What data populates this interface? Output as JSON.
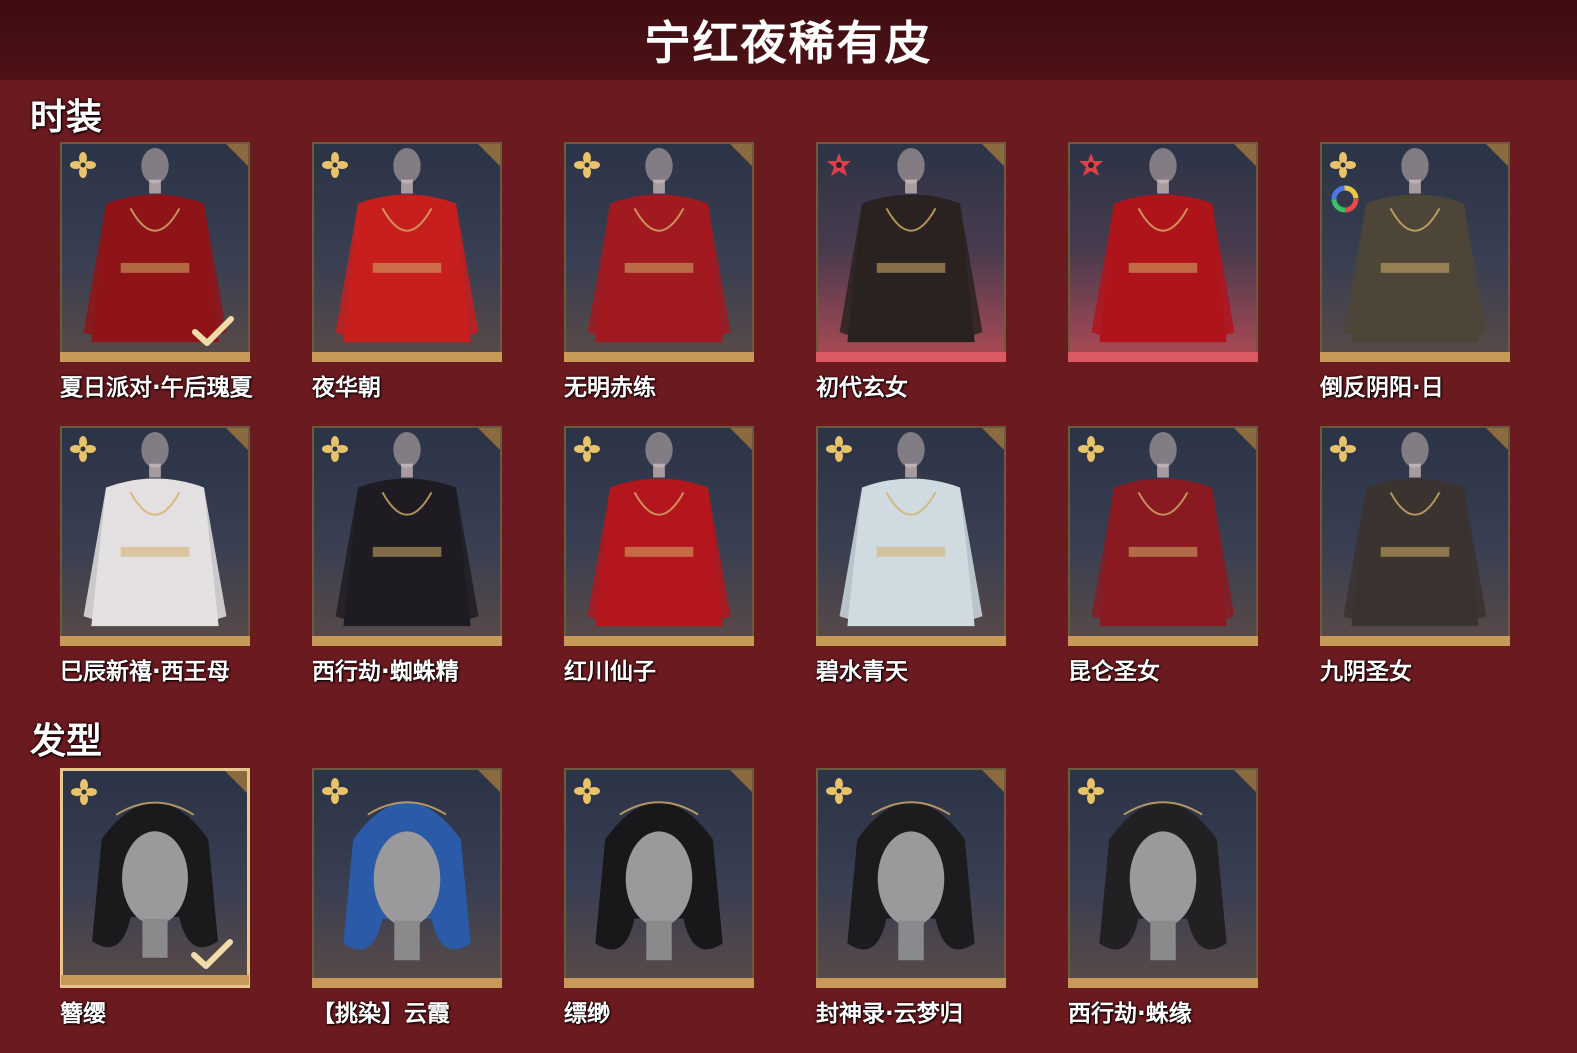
{
  "page_title": "宁红夜稀有皮",
  "sections": [
    {
      "label": "时装",
      "items": [
        {
          "name": "夏日派对·午后瑰夏",
          "rarity": "gold",
          "owned": true,
          "outfit_color": "#8e1418"
        },
        {
          "name": "夜华朝",
          "rarity": "gold",
          "owned": false,
          "outfit_color": "#c71e1e"
        },
        {
          "name": "无明赤练",
          "rarity": "gold",
          "owned": false,
          "outfit_color": "#a11a20"
        },
        {
          "name": "初代玄女",
          "rarity": "red",
          "owned": false,
          "outfit_color": "#2a2220"
        },
        {
          "name": "",
          "rarity": "red",
          "owned": false,
          "outfit_color": "#b0141b"
        },
        {
          "name": "倒反阴阳·日",
          "rarity": "gold",
          "owned": false,
          "outfit_color": "#4c4538",
          "has_color_ring": true
        },
        {
          "name": "巳辰新禧·西王母",
          "rarity": "gold",
          "owned": false,
          "outfit_color": "#e4e0e2"
        },
        {
          "name": "西行劫·蜘蛛精",
          "rarity": "gold",
          "owned": false,
          "outfit_color": "#1e1c22"
        },
        {
          "name": "红川仙子",
          "rarity": "gold",
          "owned": false,
          "outfit_color": "#b3161c"
        },
        {
          "name": "碧水青天",
          "rarity": "gold",
          "owned": false,
          "outfit_color": "#cfdbe0"
        },
        {
          "name": "昆仑圣女",
          "rarity": "gold",
          "owned": false,
          "outfit_color": "#8a1a22"
        },
        {
          "name": "九阴圣女",
          "rarity": "gold",
          "owned": false,
          "outfit_color": "#3a3330"
        }
      ]
    },
    {
      "label": "发型",
      "items": [
        {
          "name": "簪缨",
          "rarity": "gold",
          "owned": true,
          "outfit_color": "#1a1a1c",
          "selected": true
        },
        {
          "name": "【挑染】云霞",
          "rarity": "gold",
          "owned": false,
          "outfit_color": "#2b5aa8"
        },
        {
          "name": "缥缈",
          "rarity": "gold",
          "owned": false,
          "outfit_color": "#18181a"
        },
        {
          "name": "封神录·云梦归",
          "rarity": "gold",
          "owned": false,
          "outfit_color": "#1c1c1e"
        },
        {
          "name": "西行劫·蛛缘",
          "rarity": "gold",
          "owned": false,
          "outfit_color": "#222022"
        }
      ]
    }
  ],
  "colors": {
    "background": "#6b1a20",
    "gold_stripe": "#c89a5a",
    "red_stripe": "#d95a62"
  }
}
